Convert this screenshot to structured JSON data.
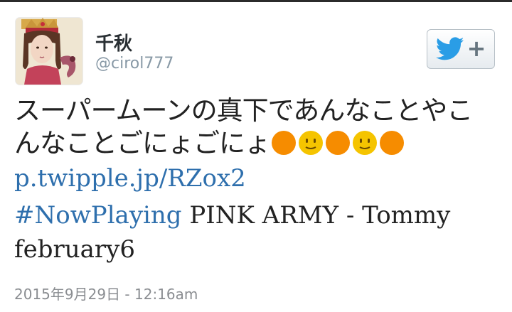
{
  "user": {
    "display_name": "千秋",
    "handle": "@cirol777"
  },
  "follow_button": {
    "icon": "twitter-bird-icon",
    "plus": "+"
  },
  "tweet": {
    "text_jp": "スーパームーンの真下であんなことやこんなことごにょごにょ",
    "emoji": [
      "orange-circle",
      "slightly-smiling-face",
      "orange-circle",
      "slightly-smiling-face",
      "orange-circle"
    ],
    "link": "p.twipple.jp/RZox2",
    "hashtag": "#NowPlaying",
    "song_line1": "PINK ARMY - Tommy",
    "song_line2": "february6"
  },
  "timestamp": "2015年9月29日 - 12:16am",
  "colors": {
    "link_blue": "#2e6fad",
    "twitter_blue": "#2a9de6",
    "emoji_orange": "#f68c00",
    "emoji_yellow": "#f5c400"
  }
}
